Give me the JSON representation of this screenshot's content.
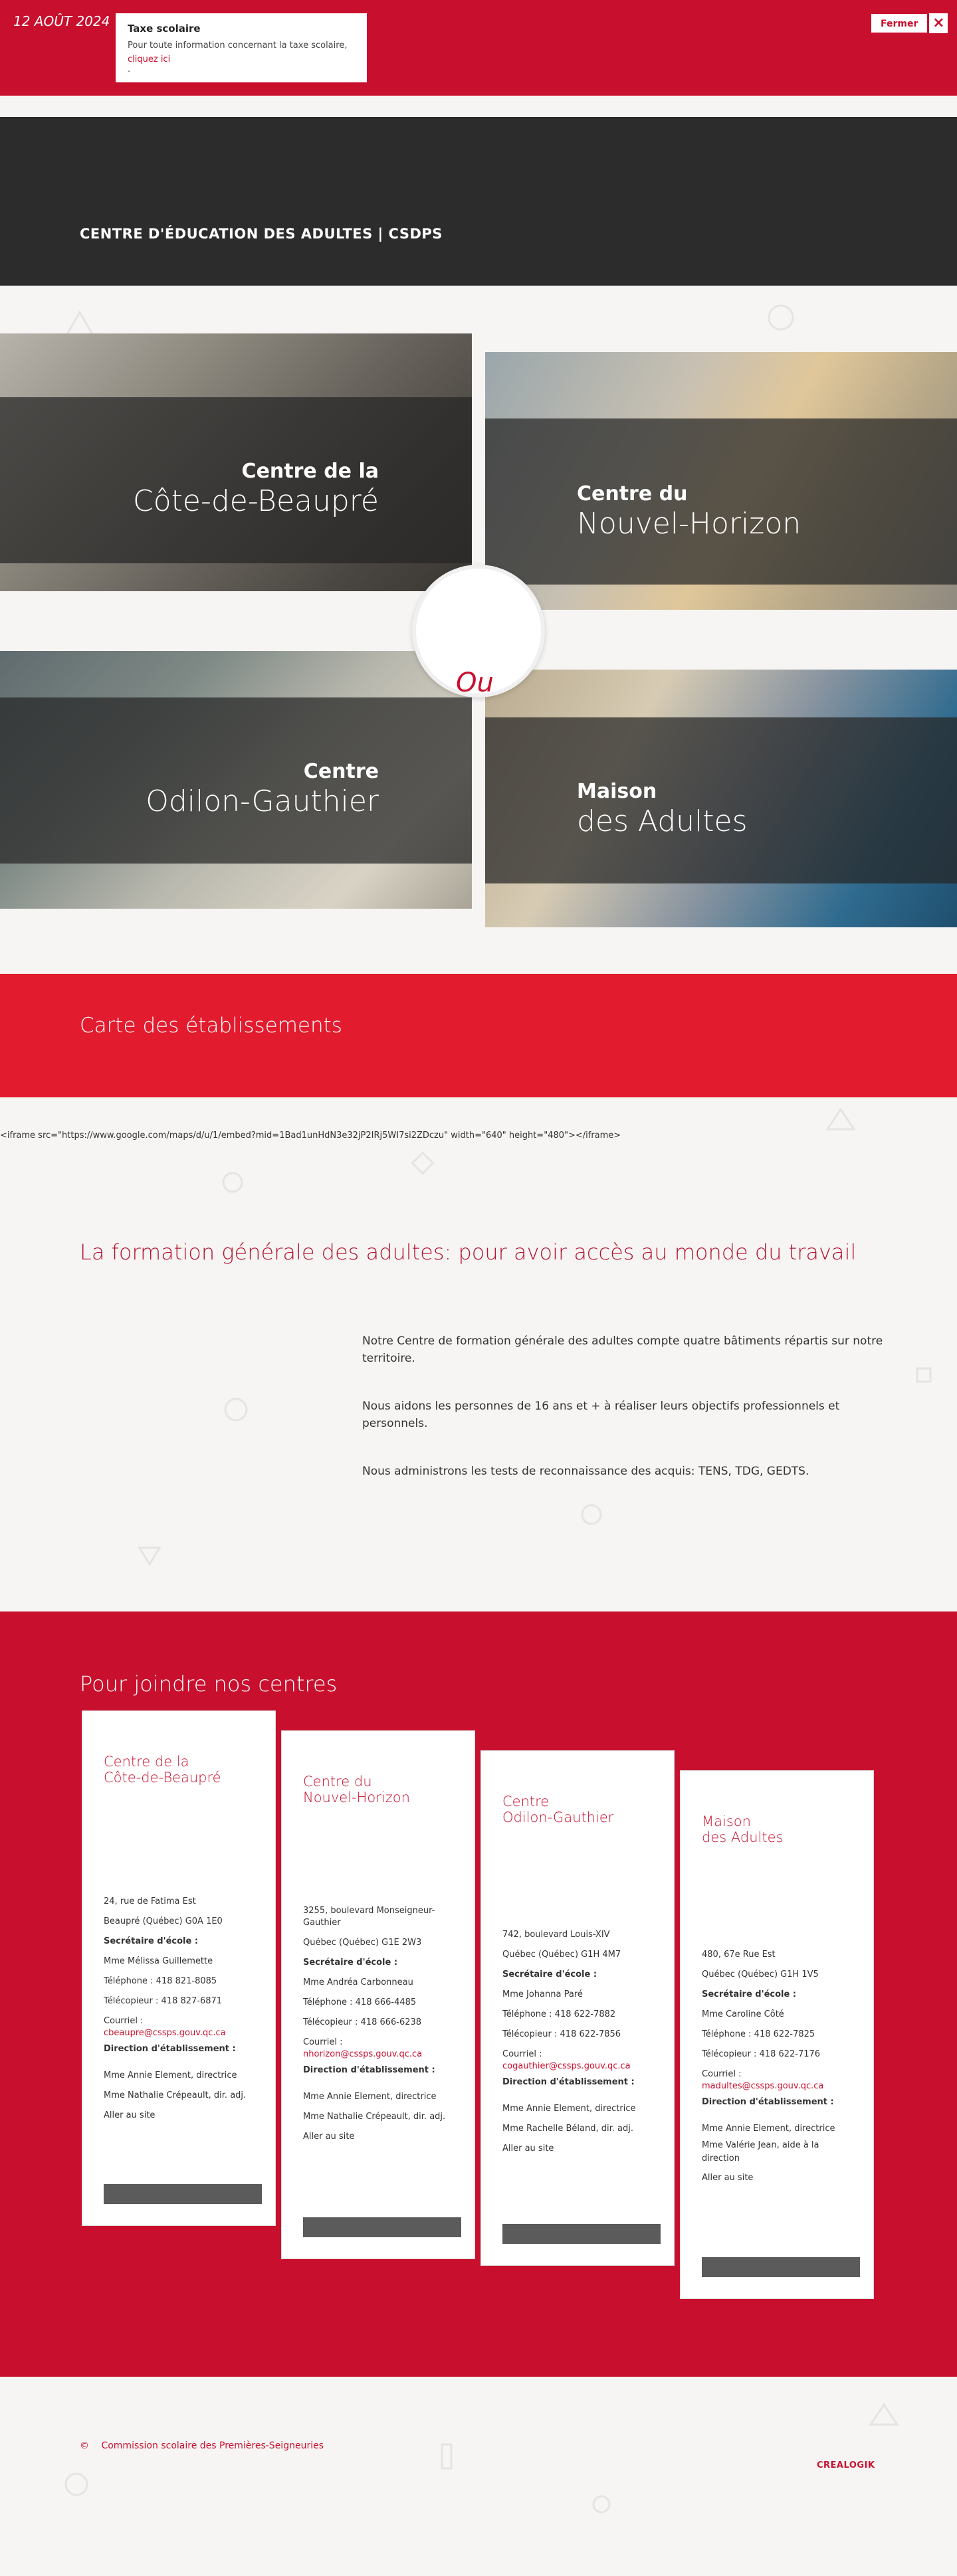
{
  "topbar": {
    "date": "12 AOÛT 2024",
    "alert_title": "Taxe scolaire",
    "alert_text": "Pour toute information concernant la taxe scolaire,",
    "alert_link": "cliquez ici",
    "alert_dot": ".",
    "close_label": "Fermer",
    "close_icon": "×"
  },
  "header": {
    "title": "CENTRE D'ÉDUCATION DES ADULTES | CSDPS"
  },
  "centers": [
    {
      "top": "Centre de la",
      "bottom": "Côte-de-Beaupré"
    },
    {
      "top": "Centre du",
      "bottom": "Nouvel-Horizon"
    },
    {
      "top": "Centre",
      "bottom": "Odilon-Gauthier"
    },
    {
      "top": "Maison",
      "bottom": "des Adultes"
    }
  ],
  "ou": "Ou",
  "map": {
    "title": "Carte des établissements",
    "iframe_text": "<iframe src=\"https://www.google.com/maps/d/u/1/embed?mid=1Bad1unHdN3e32jP2IRj5WI7si2ZDczu\" width=\"640\" height=\"480\"></iframe>"
  },
  "formation": {
    "title": "La formation générale des adultes: pour avoir accès au monde du travail",
    "paragraphs": [
      "Notre Centre de formation générale des adultes compte quatre bâtiments répartis sur notre territoire.",
      "Nous aidons les personnes de 16 ans et + à réaliser leurs objectifs professionnels et personnels.",
      "Nous administrons les tests de reconnaissance des acquis: TENS, TDG, GEDTS."
    ]
  },
  "join": {
    "title": "Pour joindre nos centres",
    "cards": [
      {
        "name1": "Centre de la",
        "name2": "Côte-de-Beaupré",
        "addr1": "24, rue de Fatima Est",
        "addr2": "Beaupré (Québec) G0A 1E0",
        "sec_label": "Secrétaire d'école :",
        "sec_name": "Mme Mélissa Guillemette",
        "tel": "Téléphone : 418 821-8085",
        "fax": "Télécopieur : 418 827-6871",
        "mail_label": "Courriel :",
        "mail": "cbeaupre@cssps.gouv.qc.ca",
        "dir_label": "Direction d'établissement :",
        "dir1": "Mme Annie Element, directrice",
        "dir2": "Mme Nathalie Crépeault, dir. adj.",
        "link": "Aller au site"
      },
      {
        "name1": "Centre du",
        "name2": "Nouvel-Horizon",
        "addr1": "3255, boulevard Monseigneur-Gauthier",
        "addr2": "Québec (Québec) G1E 2W3",
        "sec_label": "Secrétaire d'école :",
        "sec_name": "Mme Andréa Carbonneau",
        "tel": "Téléphone : 418 666-4485",
        "fax": "Télécopieur : 418 666-6238",
        "mail_label": "Courriel :",
        "mail": "nhorizon@cssps.gouv.qc.ca",
        "dir_label": "Direction d'établissement :",
        "dir1": "Mme Annie Element, directrice",
        "dir2": "Mme Nathalie Crépeault, dir. adj.",
        "link": "Aller au site"
      },
      {
        "name1": "Centre",
        "name2": "Odilon-Gauthier",
        "addr1": "742, boulevard Louis-XIV",
        "addr2": "Québec (Québec) G1H 4M7",
        "sec_label": "Secrétaire d'école :",
        "sec_name": "Mme Johanna Paré",
        "tel": "Téléphone : 418 622-7882",
        "fax": "Télécopieur : 418 622-7856",
        "mail_label": "Courriel :",
        "mail": "cogauthier@cssps.gouv.qc.ca",
        "dir_label": "Direction d'établissement :",
        "dir1": "Mme Annie Element, directrice",
        "dir2": "Mme Rachelle Béland, dir. adj.",
        "link": "Aller au site"
      },
      {
        "name1": "Maison",
        "name2": "des Adultes",
        "addr1": "480, 67e Rue Est",
        "addr2": "Québec (Québec) G1H 1V5",
        "sec_label": "Secrétaire d'école :",
        "sec_name": "Mme Caroline Côté",
        "tel": "Téléphone : 418 622-7825",
        "fax": "Télécopieur : 418 622-7176",
        "mail_label": "Courriel :",
        "mail": "madultes@cssps.gouv.qc.ca",
        "dir_label": "Direction d'établissement :",
        "dir1": "Mme Annie Element, directrice",
        "dir2": "Mme Valérie Jean, aide à la direction",
        "link": "Aller au site"
      }
    ]
  },
  "footer": {
    "copyright_symbol": "©",
    "copyright_text": "Commission scolaire des Premières-Seigneuries",
    "brand": "CREALOGIK"
  },
  "colors": {
    "primary_red": "#c8102e",
    "map_red": "#e31b2f",
    "dark_header": "#2c2c2c"
  }
}
